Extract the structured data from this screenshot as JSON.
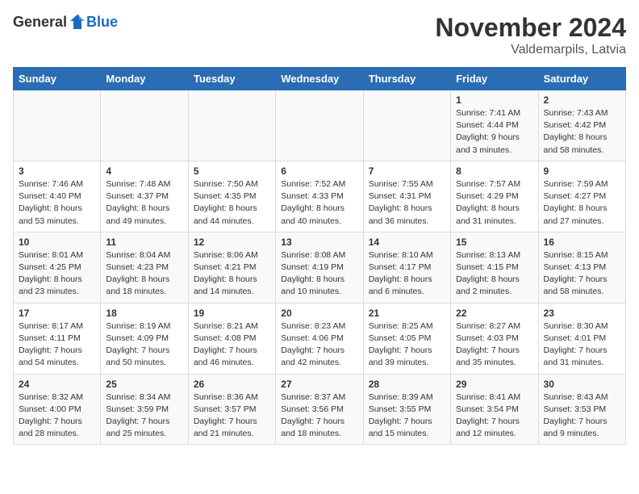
{
  "header": {
    "logo_general": "General",
    "logo_blue": "Blue",
    "title": "November 2024",
    "location": "Valdemarpils, Latvia"
  },
  "days_of_week": [
    "Sunday",
    "Monday",
    "Tuesday",
    "Wednesday",
    "Thursday",
    "Friday",
    "Saturday"
  ],
  "weeks": [
    [
      {
        "day": "",
        "info": ""
      },
      {
        "day": "",
        "info": ""
      },
      {
        "day": "",
        "info": ""
      },
      {
        "day": "",
        "info": ""
      },
      {
        "day": "",
        "info": ""
      },
      {
        "day": "1",
        "info": "Sunrise: 7:41 AM\nSunset: 4:44 PM\nDaylight: 9 hours\nand 3 minutes."
      },
      {
        "day": "2",
        "info": "Sunrise: 7:43 AM\nSunset: 4:42 PM\nDaylight: 8 hours\nand 58 minutes."
      }
    ],
    [
      {
        "day": "3",
        "info": "Sunrise: 7:46 AM\nSunset: 4:40 PM\nDaylight: 8 hours\nand 53 minutes."
      },
      {
        "day": "4",
        "info": "Sunrise: 7:48 AM\nSunset: 4:37 PM\nDaylight: 8 hours\nand 49 minutes."
      },
      {
        "day": "5",
        "info": "Sunrise: 7:50 AM\nSunset: 4:35 PM\nDaylight: 8 hours\nand 44 minutes."
      },
      {
        "day": "6",
        "info": "Sunrise: 7:52 AM\nSunset: 4:33 PM\nDaylight: 8 hours\nand 40 minutes."
      },
      {
        "day": "7",
        "info": "Sunrise: 7:55 AM\nSunset: 4:31 PM\nDaylight: 8 hours\nand 36 minutes."
      },
      {
        "day": "8",
        "info": "Sunrise: 7:57 AM\nSunset: 4:29 PM\nDaylight: 8 hours\nand 31 minutes."
      },
      {
        "day": "9",
        "info": "Sunrise: 7:59 AM\nSunset: 4:27 PM\nDaylight: 8 hours\nand 27 minutes."
      }
    ],
    [
      {
        "day": "10",
        "info": "Sunrise: 8:01 AM\nSunset: 4:25 PM\nDaylight: 8 hours\nand 23 minutes."
      },
      {
        "day": "11",
        "info": "Sunrise: 8:04 AM\nSunset: 4:23 PM\nDaylight: 8 hours\nand 18 minutes."
      },
      {
        "day": "12",
        "info": "Sunrise: 8:06 AM\nSunset: 4:21 PM\nDaylight: 8 hours\nand 14 minutes."
      },
      {
        "day": "13",
        "info": "Sunrise: 8:08 AM\nSunset: 4:19 PM\nDaylight: 8 hours\nand 10 minutes."
      },
      {
        "day": "14",
        "info": "Sunrise: 8:10 AM\nSunset: 4:17 PM\nDaylight: 8 hours\nand 6 minutes."
      },
      {
        "day": "15",
        "info": "Sunrise: 8:13 AM\nSunset: 4:15 PM\nDaylight: 8 hours\nand 2 minutes."
      },
      {
        "day": "16",
        "info": "Sunrise: 8:15 AM\nSunset: 4:13 PM\nDaylight: 7 hours\nand 58 minutes."
      }
    ],
    [
      {
        "day": "17",
        "info": "Sunrise: 8:17 AM\nSunset: 4:11 PM\nDaylight: 7 hours\nand 54 minutes."
      },
      {
        "day": "18",
        "info": "Sunrise: 8:19 AM\nSunset: 4:09 PM\nDaylight: 7 hours\nand 50 minutes."
      },
      {
        "day": "19",
        "info": "Sunrise: 8:21 AM\nSunset: 4:08 PM\nDaylight: 7 hours\nand 46 minutes."
      },
      {
        "day": "20",
        "info": "Sunrise: 8:23 AM\nSunset: 4:06 PM\nDaylight: 7 hours\nand 42 minutes."
      },
      {
        "day": "21",
        "info": "Sunrise: 8:25 AM\nSunset: 4:05 PM\nDaylight: 7 hours\nand 39 minutes."
      },
      {
        "day": "22",
        "info": "Sunrise: 8:27 AM\nSunset: 4:03 PM\nDaylight: 7 hours\nand 35 minutes."
      },
      {
        "day": "23",
        "info": "Sunrise: 8:30 AM\nSunset: 4:01 PM\nDaylight: 7 hours\nand 31 minutes."
      }
    ],
    [
      {
        "day": "24",
        "info": "Sunrise: 8:32 AM\nSunset: 4:00 PM\nDaylight: 7 hours\nand 28 minutes."
      },
      {
        "day": "25",
        "info": "Sunrise: 8:34 AM\nSunset: 3:59 PM\nDaylight: 7 hours\nand 25 minutes."
      },
      {
        "day": "26",
        "info": "Sunrise: 8:36 AM\nSunset: 3:57 PM\nDaylight: 7 hours\nand 21 minutes."
      },
      {
        "day": "27",
        "info": "Sunrise: 8:37 AM\nSunset: 3:56 PM\nDaylight: 7 hours\nand 18 minutes."
      },
      {
        "day": "28",
        "info": "Sunrise: 8:39 AM\nSunset: 3:55 PM\nDaylight: 7 hours\nand 15 minutes."
      },
      {
        "day": "29",
        "info": "Sunrise: 8:41 AM\nSunset: 3:54 PM\nDaylight: 7 hours\nand 12 minutes."
      },
      {
        "day": "30",
        "info": "Sunrise: 8:43 AM\nSunset: 3:53 PM\nDaylight: 7 hours\nand 9 minutes."
      }
    ]
  ]
}
